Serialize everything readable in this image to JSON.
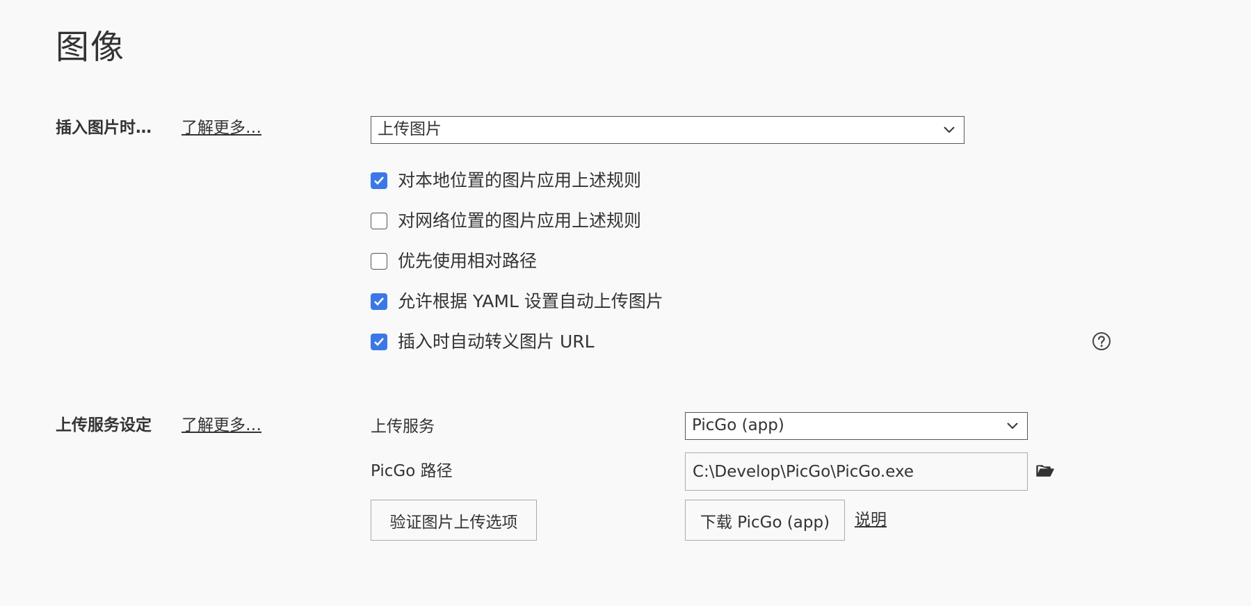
{
  "page": {
    "title": "图像"
  },
  "insert_section": {
    "label": "插入图片时…",
    "learn_more": "了解更多…",
    "action_select": "上传图片",
    "options": [
      {
        "label": "对本地位置的图片应用上述规则",
        "checked": true
      },
      {
        "label": "对网络位置的图片应用上述规则",
        "checked": false
      },
      {
        "label": "优先使用相对路径",
        "checked": false
      },
      {
        "label": "允许根据 YAML 设置自动上传图片",
        "checked": true
      },
      {
        "label": "插入时自动转义图片 URL",
        "checked": true
      }
    ],
    "help_icon": "question-circle-icon"
  },
  "upload_section": {
    "label": "上传服务设定",
    "learn_more": "了解更多…",
    "service_label": "上传服务",
    "service_select": "PicGo (app)",
    "path_label": "PicGo 路径",
    "path_value": "C:\\Develop\\PicGo\\PicGo.exe",
    "folder_icon": "folder-open-icon",
    "verify_button": "验证图片上传选项",
    "download_button": "下载 PicGo (app)",
    "explain_link": "说明"
  },
  "colors": {
    "background": "#f9f9f9",
    "checkbox_on": "#3b78e7",
    "text": "#333333"
  }
}
